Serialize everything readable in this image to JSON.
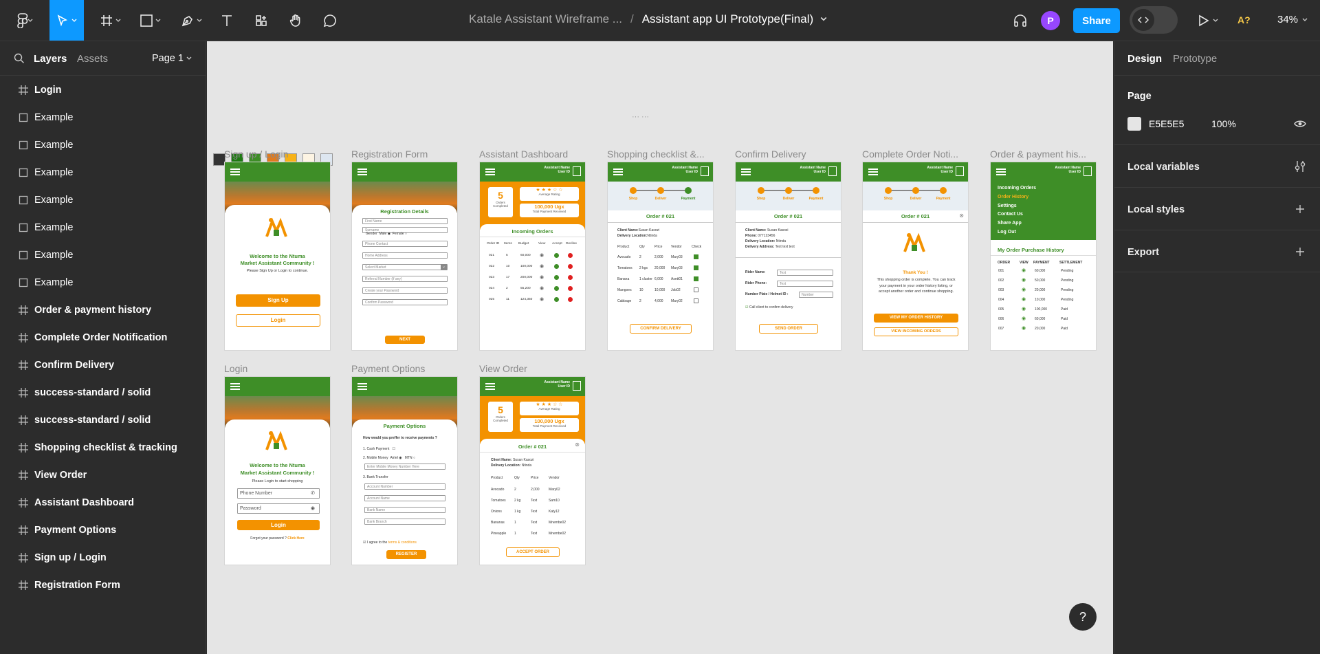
{
  "topbar": {
    "file_project": "Katale Assistant Wireframe ...",
    "separator": "/",
    "file_name": "Assistant app UI Prototype(Final)",
    "avatar_letter": "P",
    "share_label": "Share",
    "zoom": "34%",
    "ai_label": "A?"
  },
  "left": {
    "tab_layers": "Layers",
    "tab_assets": "Assets",
    "page_select": "Page 1",
    "layers": [
      {
        "label": "Login",
        "icon": "frame-icon"
      },
      {
        "label": "Example",
        "icon": "rect-icon"
      },
      {
        "label": "Example",
        "icon": "rect-icon"
      },
      {
        "label": "Example",
        "icon": "rect-icon"
      },
      {
        "label": "Example",
        "icon": "rect-icon"
      },
      {
        "label": "Example",
        "icon": "rect-icon"
      },
      {
        "label": "Example",
        "icon": "rect-icon"
      },
      {
        "label": "Example",
        "icon": "rect-icon"
      },
      {
        "label": "Order & payment history",
        "icon": "frame-icon"
      },
      {
        "label": "Complete Order Notification",
        "icon": "frame-icon"
      },
      {
        "label": "Confirm Delivery",
        "icon": "frame-icon"
      },
      {
        "label": "success-standard / solid",
        "icon": "frame-icon"
      },
      {
        "label": "success-standard / solid",
        "icon": "frame-icon"
      },
      {
        "label": "Shopping checklist & tracking",
        "icon": "frame-icon"
      },
      {
        "label": "View Order",
        "icon": "frame-icon"
      },
      {
        "label": "Assistant Dashboard",
        "icon": "frame-icon"
      },
      {
        "label": "Payment Options",
        "icon": "frame-icon"
      },
      {
        "label": "Sign up / Login",
        "icon": "frame-icon"
      },
      {
        "label": "Registration Form",
        "icon": "frame-icon"
      }
    ]
  },
  "right": {
    "tab_design": "Design",
    "tab_prototype": "Prototype",
    "page_heading": "Page",
    "page_color": "E5E5E5",
    "page_opacity": "100%",
    "local_variables": "Local variables",
    "local_styles": "Local styles",
    "export": "Export"
  },
  "canvas": {
    "swatches": [
      "#333333",
      "#1e7a12",
      "#3e8e27",
      "#e07b1f",
      "#f7b217",
      "#fdf4e3",
      "#dde6f0"
    ],
    "frame_labels": {
      "signup": "Sign up / Login",
      "registration": "Registration Form",
      "dashboard": "Assistant Dashboard",
      "shopping": "Shopping checklist &...",
      "confirm": "Confirm Delivery",
      "complete": "Complete Order Noti...",
      "history": "Order & payment his...",
      "login": "Login",
      "payment": "Payment Options",
      "vieworder": "View Order"
    },
    "app": {
      "assistant_name": "Assistant Name",
      "user_id": "User ID",
      "welcome_line1": "Welcome to the Ntuma",
      "welcome_line2": "Market Assistant Community !",
      "signup_sub": "Please Sign Up or Login to continue.",
      "signup_btn": "Sign Up",
      "login_btn": "Login",
      "login_sub": "Please Login to start shopping",
      "phone_placeholder": "Phone Number",
      "password_placeholder": "Password",
      "forgot": "Forgot your password ?",
      "click_here": "Click Here",
      "reg_title": "Registration Details",
      "reg_fields": [
        "First Name",
        "Surname",
        "Phone Contact",
        "Home Address",
        "Select Market",
        "Referral Number (if any)",
        "Create your Password",
        "Confirm Password"
      ],
      "gender": "Gender",
      "male": "Male",
      "female": "Female",
      "next_btn": "NEXT",
      "orders_count": "5",
      "orders_completed": "Orders Completed",
      "stars": "★ ★ ★ ☆ ☆",
      "avg_rating": "Average Rating",
      "payment_total": "100,000 Ugx",
      "payment_received": "Total Payment Received",
      "incoming_orders": "Incoming Orders",
      "dash_headers": [
        "Order ID",
        "Items",
        "Budget",
        "View",
        "Accept",
        "Decline"
      ],
      "dash_rows": [
        [
          "021",
          "5",
          "60,000"
        ],
        [
          "022",
          "10",
          "100,000"
        ],
        [
          "023",
          "17",
          "200,000"
        ],
        [
          "024",
          "2",
          "55,200"
        ],
        [
          "025",
          "11",
          "124,350"
        ]
      ],
      "steps": [
        "Shop",
        "Deliver",
        "Payment"
      ],
      "order_no": "Order # 021",
      "client_label": "Client Name:",
      "client_name": "Susan Kasozi",
      "delivery_label": "Delivery Location:",
      "delivery_loc": "Ntinda",
      "phone_label": "Phone:",
      "phone_val": "077123456",
      "address_label": "Delivery Address:",
      "address_val": "Text text text",
      "product_headers": [
        "Product",
        "Qty",
        "Price",
        "Vendor",
        "Check"
      ],
      "product_rows": [
        [
          "Avocado",
          "2",
          "2,000",
          "Mary03"
        ],
        [
          "Tomatoes",
          "2 kgs",
          "20,000",
          "Mary03"
        ],
        [
          "Banana",
          "1 cluster",
          "6,000",
          "Asett01"
        ],
        [
          "Mangoes",
          "10",
          "10,000",
          "Job02"
        ],
        [
          "Cabbage",
          "2",
          "4,000",
          "Mary02"
        ]
      ],
      "confirm_delivery_btn": "CONFIRM DELIVERY",
      "rider_name": "Rider Name:",
      "rider_phone": "Rider Phone:",
      "plate": "Number Plate / Helmet ID :",
      "text_ph": "Text",
      "number_ph": "Number",
      "call_client": "Call client to confirm delivery",
      "send_order_btn": "SEND ORDER",
      "thank_you": "Thank You !",
      "complete_msg": "This shopping order is complete. You can track your payment in your order history listing, or accept another order and continue shopping.",
      "view_history_btn": "VIEW MY ORDER HISTORY",
      "view_incoming_btn": "VIEW INCOMING ORDERS",
      "menu_items": [
        "Incoming Orders",
        "Order History",
        "Settings",
        "Contact Us",
        "Share App",
        "Log Out"
      ],
      "history_title": "My Order Purchase History",
      "history_headers": [
        "ORDER",
        "VIEW",
        "PAYMENT",
        "SETTLEMENT"
      ],
      "history_rows": [
        [
          "001",
          "60,000",
          "Pending"
        ],
        [
          "002",
          "50,000",
          "Pending"
        ],
        [
          "003",
          "20,000",
          "Pending"
        ],
        [
          "004",
          "10,000",
          "Pending"
        ],
        [
          "005",
          "100,000",
          "Paid"
        ],
        [
          "006",
          "60,000",
          "Paid"
        ],
        [
          "007",
          "20,000",
          "Paid"
        ]
      ],
      "pay_title": "Payment Options",
      "pay_question": "How would you preffer to receive payments ?",
      "pay_opt1": "1. Cash Payment",
      "pay_opt2": "2. Mobile Money",
      "airtel": "Airtel",
      "mtn": "MTN",
      "mm_placeholder": "Enter Mobile Money Number Here",
      "pay_opt3": "3. Bank Transfer",
      "bank_fields": [
        "Account Number",
        "Account Name",
        "Bank Name",
        "Bank Branch"
      ],
      "agree": "I agree to the",
      "terms": "terms & conditions",
      "register_btn": "REGISTER",
      "view_rows": [
        [
          "Avocado",
          "2",
          "2,000",
          "Mary02"
        ],
        [
          "Tomatoes",
          "2 kg",
          "Text",
          "Sam10"
        ],
        [
          "Onions",
          "1 kg",
          "Text",
          "Katy12"
        ],
        [
          "Bananas",
          "1",
          "Text",
          "Mnembe02"
        ],
        [
          "Pineapple",
          "1",
          "Text",
          "Mnembe02"
        ]
      ],
      "view_headers": [
        "Product",
        "Qty",
        "Price",
        "Vendor"
      ],
      "accept_order_btn": "ACCEPT ORDER"
    }
  }
}
